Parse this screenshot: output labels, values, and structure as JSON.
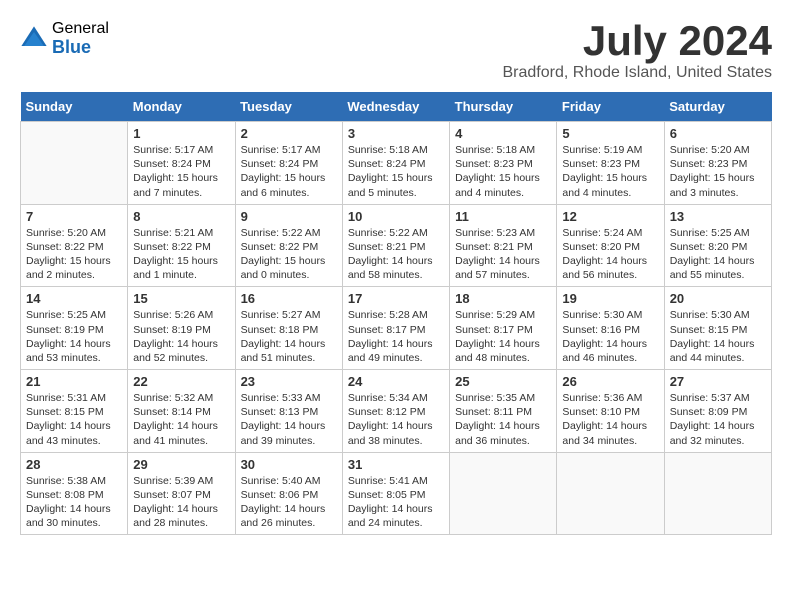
{
  "logo": {
    "general": "General",
    "blue": "Blue"
  },
  "title": "July 2024",
  "location": "Bradford, Rhode Island, United States",
  "weekdays": [
    "Sunday",
    "Monday",
    "Tuesday",
    "Wednesday",
    "Thursday",
    "Friday",
    "Saturday"
  ],
  "weeks": [
    [
      {
        "day": "",
        "info": ""
      },
      {
        "day": "1",
        "info": "Sunrise: 5:17 AM\nSunset: 8:24 PM\nDaylight: 15 hours\nand 7 minutes."
      },
      {
        "day": "2",
        "info": "Sunrise: 5:17 AM\nSunset: 8:24 PM\nDaylight: 15 hours\nand 6 minutes."
      },
      {
        "day": "3",
        "info": "Sunrise: 5:18 AM\nSunset: 8:24 PM\nDaylight: 15 hours\nand 5 minutes."
      },
      {
        "day": "4",
        "info": "Sunrise: 5:18 AM\nSunset: 8:23 PM\nDaylight: 15 hours\nand 4 minutes."
      },
      {
        "day": "5",
        "info": "Sunrise: 5:19 AM\nSunset: 8:23 PM\nDaylight: 15 hours\nand 4 minutes."
      },
      {
        "day": "6",
        "info": "Sunrise: 5:20 AM\nSunset: 8:23 PM\nDaylight: 15 hours\nand 3 minutes."
      }
    ],
    [
      {
        "day": "7",
        "info": "Sunrise: 5:20 AM\nSunset: 8:22 PM\nDaylight: 15 hours\nand 2 minutes."
      },
      {
        "day": "8",
        "info": "Sunrise: 5:21 AM\nSunset: 8:22 PM\nDaylight: 15 hours\nand 1 minute."
      },
      {
        "day": "9",
        "info": "Sunrise: 5:22 AM\nSunset: 8:22 PM\nDaylight: 15 hours\nand 0 minutes."
      },
      {
        "day": "10",
        "info": "Sunrise: 5:22 AM\nSunset: 8:21 PM\nDaylight: 14 hours\nand 58 minutes."
      },
      {
        "day": "11",
        "info": "Sunrise: 5:23 AM\nSunset: 8:21 PM\nDaylight: 14 hours\nand 57 minutes."
      },
      {
        "day": "12",
        "info": "Sunrise: 5:24 AM\nSunset: 8:20 PM\nDaylight: 14 hours\nand 56 minutes."
      },
      {
        "day": "13",
        "info": "Sunrise: 5:25 AM\nSunset: 8:20 PM\nDaylight: 14 hours\nand 55 minutes."
      }
    ],
    [
      {
        "day": "14",
        "info": "Sunrise: 5:25 AM\nSunset: 8:19 PM\nDaylight: 14 hours\nand 53 minutes."
      },
      {
        "day": "15",
        "info": "Sunrise: 5:26 AM\nSunset: 8:19 PM\nDaylight: 14 hours\nand 52 minutes."
      },
      {
        "day": "16",
        "info": "Sunrise: 5:27 AM\nSunset: 8:18 PM\nDaylight: 14 hours\nand 51 minutes."
      },
      {
        "day": "17",
        "info": "Sunrise: 5:28 AM\nSunset: 8:17 PM\nDaylight: 14 hours\nand 49 minutes."
      },
      {
        "day": "18",
        "info": "Sunrise: 5:29 AM\nSunset: 8:17 PM\nDaylight: 14 hours\nand 48 minutes."
      },
      {
        "day": "19",
        "info": "Sunrise: 5:30 AM\nSunset: 8:16 PM\nDaylight: 14 hours\nand 46 minutes."
      },
      {
        "day": "20",
        "info": "Sunrise: 5:30 AM\nSunset: 8:15 PM\nDaylight: 14 hours\nand 44 minutes."
      }
    ],
    [
      {
        "day": "21",
        "info": "Sunrise: 5:31 AM\nSunset: 8:15 PM\nDaylight: 14 hours\nand 43 minutes."
      },
      {
        "day": "22",
        "info": "Sunrise: 5:32 AM\nSunset: 8:14 PM\nDaylight: 14 hours\nand 41 minutes."
      },
      {
        "day": "23",
        "info": "Sunrise: 5:33 AM\nSunset: 8:13 PM\nDaylight: 14 hours\nand 39 minutes."
      },
      {
        "day": "24",
        "info": "Sunrise: 5:34 AM\nSunset: 8:12 PM\nDaylight: 14 hours\nand 38 minutes."
      },
      {
        "day": "25",
        "info": "Sunrise: 5:35 AM\nSunset: 8:11 PM\nDaylight: 14 hours\nand 36 minutes."
      },
      {
        "day": "26",
        "info": "Sunrise: 5:36 AM\nSunset: 8:10 PM\nDaylight: 14 hours\nand 34 minutes."
      },
      {
        "day": "27",
        "info": "Sunrise: 5:37 AM\nSunset: 8:09 PM\nDaylight: 14 hours\nand 32 minutes."
      }
    ],
    [
      {
        "day": "28",
        "info": "Sunrise: 5:38 AM\nSunset: 8:08 PM\nDaylight: 14 hours\nand 30 minutes."
      },
      {
        "day": "29",
        "info": "Sunrise: 5:39 AM\nSunset: 8:07 PM\nDaylight: 14 hours\nand 28 minutes."
      },
      {
        "day": "30",
        "info": "Sunrise: 5:40 AM\nSunset: 8:06 PM\nDaylight: 14 hours\nand 26 minutes."
      },
      {
        "day": "31",
        "info": "Sunrise: 5:41 AM\nSunset: 8:05 PM\nDaylight: 14 hours\nand 24 minutes."
      },
      {
        "day": "",
        "info": ""
      },
      {
        "day": "",
        "info": ""
      },
      {
        "day": "",
        "info": ""
      }
    ]
  ]
}
